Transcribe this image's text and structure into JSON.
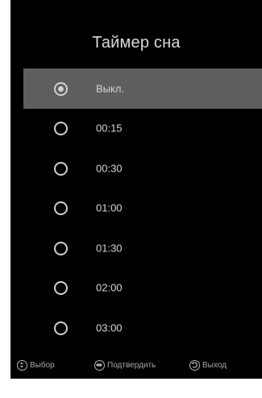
{
  "dialog": {
    "title": "Таймер сна"
  },
  "options": [
    {
      "label": "Выкл.",
      "selected": true
    },
    {
      "label": "00:15",
      "selected": false
    },
    {
      "label": "00:30",
      "selected": false
    },
    {
      "label": "01:00",
      "selected": false
    },
    {
      "label": "01:30",
      "selected": false
    },
    {
      "label": "02:00",
      "selected": false
    },
    {
      "label": "03:00",
      "selected": false
    }
  ],
  "footer": {
    "select_label": "Выбор",
    "select_icon": "dpad-updown-icon",
    "confirm_label": "Подтвердить",
    "confirm_icon": "ok-button-icon",
    "exit_label": "Выход",
    "exit_icon": "back-arrow-icon"
  },
  "colors": {
    "background": "#000000",
    "highlight": "#5e5e5e",
    "text": "#d6d6d6"
  }
}
